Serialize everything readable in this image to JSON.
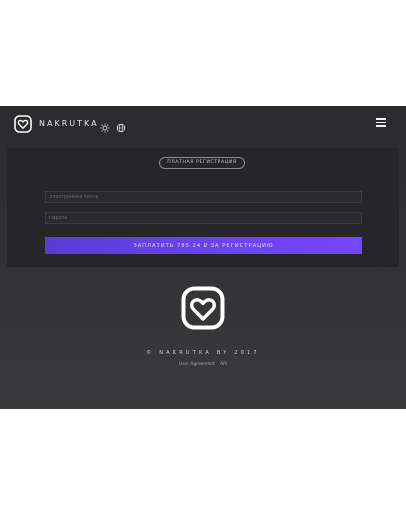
{
  "header": {
    "brand": "NAKRUTKA",
    "logo_icon": "heart-square-icon",
    "theme_icon": "sun-icon",
    "language_icon": "globe-icon",
    "menu_icon": "hamburger-menu-icon"
  },
  "form": {
    "mode_label": "ПЛАТНАЯ РЕГИСТРАЦИЯ",
    "email_placeholder": "Электронная почта",
    "email_value": "",
    "password_placeholder": "Пароль",
    "password_value": "",
    "submit_label": "ЗАПЛАТИТЬ 785.24 ₽ ЗА РЕГИСТРАЦИЮ"
  },
  "footer": {
    "logo_icon": "heart-square-icon",
    "copyright": "© NAKRUTKA BY 2017",
    "links": [
      "User Agreement",
      "API"
    ]
  },
  "colors": {
    "background_top": "#2b2b2d",
    "background_bottom": "#3a3a3c",
    "panel": "#262628",
    "accent_start": "#5a3bd6",
    "accent_end": "#7446ff",
    "text": "#e9e9ee"
  }
}
